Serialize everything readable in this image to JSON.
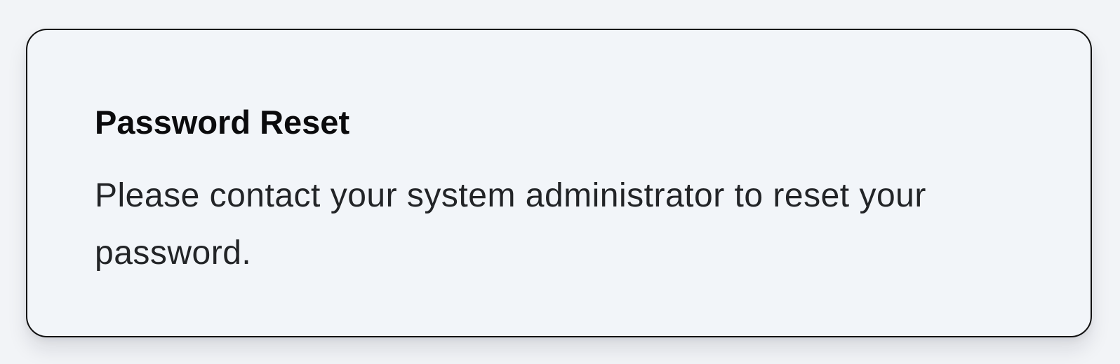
{
  "card": {
    "title": "Password Reset",
    "message": "Please contact your system administrator to reset your password."
  },
  "colors": {
    "background": "#f2f4f7",
    "card_background": "#f2f5f9",
    "card_border": "#111111",
    "title_text": "#0b0b0d",
    "body_text": "#222427"
  }
}
